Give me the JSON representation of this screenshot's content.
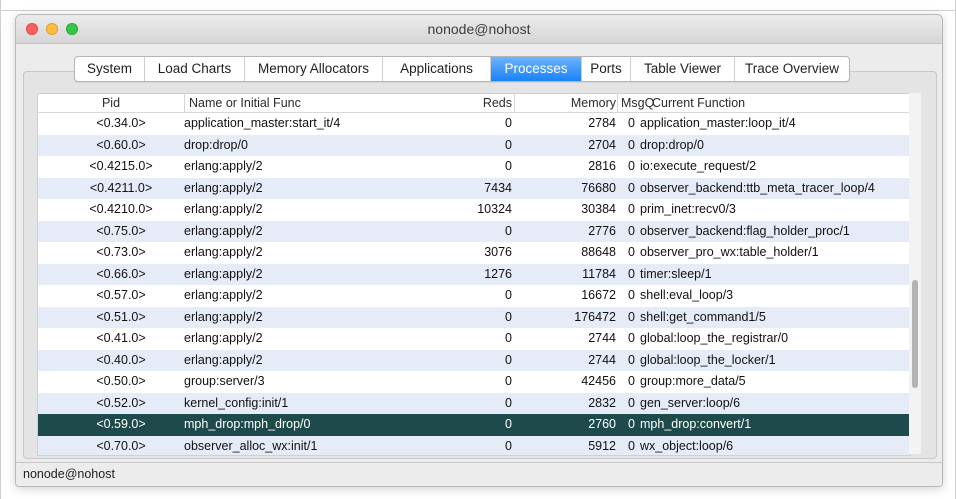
{
  "window": {
    "title": "nonode@nohost"
  },
  "tabs": [
    {
      "label": "System",
      "active": false
    },
    {
      "label": "Load Charts",
      "active": false
    },
    {
      "label": "Memory Allocators",
      "active": false
    },
    {
      "label": "Applications",
      "active": false
    },
    {
      "label": "Processes",
      "active": true
    },
    {
      "label": "Ports",
      "active": false
    },
    {
      "label": "Table Viewer",
      "active": false
    },
    {
      "label": "Trace Overview",
      "active": false
    }
  ],
  "table": {
    "columns": [
      "Pid",
      "Name or Initial Func",
      "Reds",
      "Memory",
      "MsgQ",
      "Current Function"
    ],
    "rows": [
      [
        "<0.34.0>",
        "application_master:start_it/4",
        "0",
        "2784",
        "0",
        "application_master:loop_it/4"
      ],
      [
        "<0.60.0>",
        "drop:drop/0",
        "0",
        "2704",
        "0",
        "drop:drop/0"
      ],
      [
        "<0.4215.0>",
        "erlang:apply/2",
        "0",
        "2816",
        "0",
        "io:execute_request/2"
      ],
      [
        "<0.4211.0>",
        "erlang:apply/2",
        "7434",
        "76680",
        "0",
        "observer_backend:ttb_meta_tracer_loop/4"
      ],
      [
        "<0.4210.0>",
        "erlang:apply/2",
        "10324",
        "30384",
        "0",
        "prim_inet:recv0/3"
      ],
      [
        "<0.75.0>",
        "erlang:apply/2",
        "0",
        "2776",
        "0",
        "observer_backend:flag_holder_proc/1"
      ],
      [
        "<0.73.0>",
        "erlang:apply/2",
        "3076",
        "88648",
        "0",
        "observer_pro_wx:table_holder/1"
      ],
      [
        "<0.66.0>",
        "erlang:apply/2",
        "1276",
        "11784",
        "0",
        "timer:sleep/1"
      ],
      [
        "<0.57.0>",
        "erlang:apply/2",
        "0",
        "16672",
        "0",
        "shell:eval_loop/3"
      ],
      [
        "<0.51.0>",
        "erlang:apply/2",
        "0",
        "176472",
        "0",
        "shell:get_command1/5"
      ],
      [
        "<0.41.0>",
        "erlang:apply/2",
        "0",
        "2744",
        "0",
        "global:loop_the_registrar/0"
      ],
      [
        "<0.40.0>",
        "erlang:apply/2",
        "0",
        "2744",
        "0",
        "global:loop_the_locker/1"
      ],
      [
        "<0.50.0>",
        "group:server/3",
        "0",
        "42456",
        "0",
        "group:more_data/5"
      ],
      [
        "<0.52.0>",
        "kernel_config:init/1",
        "0",
        "2832",
        "0",
        "gen_server:loop/6"
      ],
      [
        "<0.59.0>",
        "mph_drop:mph_drop/0",
        "0",
        "2760",
        "0",
        "mph_drop:convert/1"
      ],
      [
        "<0.70.0>",
        "observer_alloc_wx:init/1",
        "0",
        "5912",
        "0",
        "wx_object:loop/6"
      ]
    ],
    "selected_row": 14
  },
  "statusbar": {
    "text": "nonode@nohost"
  },
  "colors": {
    "accent": "#1a82fb",
    "selected_row": "#1f4a4b",
    "stripe": "#e6ebf8"
  }
}
